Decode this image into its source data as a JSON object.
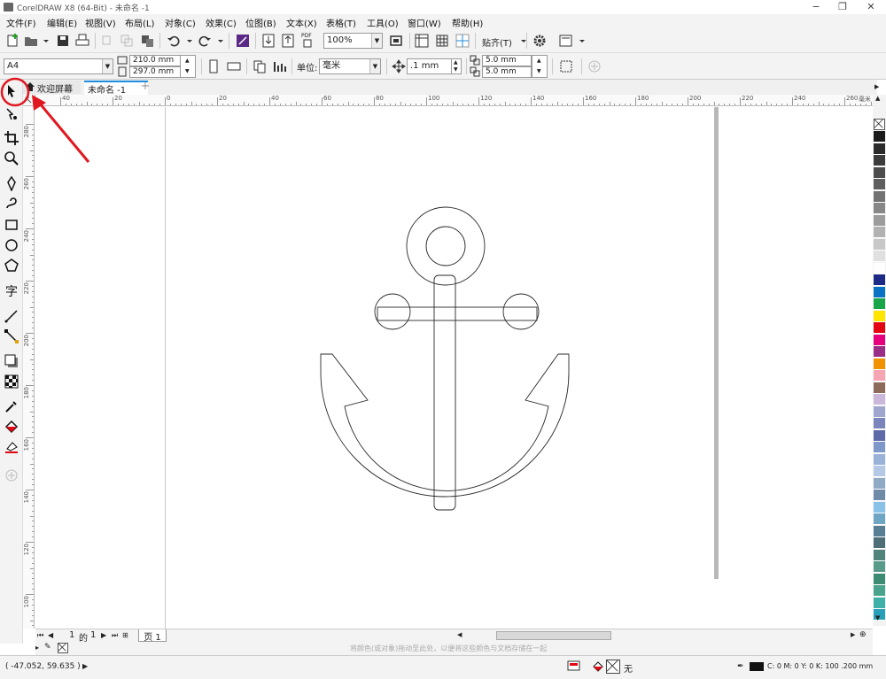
{
  "window": {
    "title": "CorelDRAW X8 (64-Bit) - 未命名 -1",
    "min": "−",
    "max": "❐",
    "close": "✕"
  },
  "menu": [
    "文件(F)",
    "编辑(E)",
    "视图(V)",
    "布局(L)",
    "对象(C)",
    "效果(C)",
    "位图(B)",
    "文本(X)",
    "表格(T)",
    "工具(O)",
    "窗口(W)",
    "帮助(H)"
  ],
  "toolbar": {
    "zoom": "100%",
    "snap": "贴齐(T)",
    "pdf": "PDF"
  },
  "propbar": {
    "paper": "A4",
    "width": "210.0 mm",
    "height": "297.0 mm",
    "units_label": "单位:",
    "units": "毫米",
    "nudge": ".1 mm",
    "dup_x": "5.0 mm",
    "dup_y": "5.0 mm"
  },
  "tabs": {
    "welcome": "欢迎屏幕",
    "doc": "未命名 -1",
    "add": "+"
  },
  "hruler_labels": [
    "40",
    "20",
    "0",
    "20",
    "40",
    "60",
    "80",
    "100",
    "120",
    "140",
    "160",
    "180",
    "200",
    "220",
    "240",
    "260"
  ],
  "hruler_unit": "毫米",
  "vruler_labels": [
    "280",
    "260",
    "240",
    "220",
    "200",
    "180",
    "160",
    "140",
    "120",
    "100"
  ],
  "pagenav": {
    "current": "1",
    "of": "的",
    "total": "1",
    "page_tab": "页 1"
  },
  "drop_hint": "将颜色(或对象)拖动至此处，以便将这些颜色与文档存储在一起",
  "status": {
    "coords": "( -47.052, 59.635 )",
    "fill_none": "无",
    "color_info": "C: 0 M: 0 Y: 0 K: 100 .200 mm"
  },
  "palette_colors": [
    "#1b1b1b",
    "#2b2b2b",
    "#3c3c3c",
    "#4d4d4d",
    "#5f5f5f",
    "#727272",
    "#878787",
    "#9c9c9c",
    "#b2b2b2",
    "#c8c8c8",
    "#e0e0e0",
    "#ffffff",
    "#1d2a86",
    "#0a72c4",
    "#19a64a",
    "#ffe600",
    "#e30613",
    "#e6007e",
    "#9b2d86",
    "#f39200",
    "#f6a6b2",
    "#8d6b5a",
    "#c9b8da",
    "#9fa7cf",
    "#7a84bd",
    "#5e6aa8",
    "#7e98c9",
    "#9ab2d8",
    "#b5c8e5",
    "#90a9c4",
    "#6f8ba8",
    "#8ac1e6",
    "#6fa6c6",
    "#587e94",
    "#4f6f78",
    "#50847b",
    "#5a9a8a",
    "#3c8c74",
    "#4aa38d",
    "#3fb0a8",
    "#2aa0b8"
  ],
  "colors": {
    "accent_blue": "#1e8de0",
    "ruler_bg": "#fafafa",
    "chrome": "#f3f3f3",
    "annotation_red": "#e0171f"
  }
}
